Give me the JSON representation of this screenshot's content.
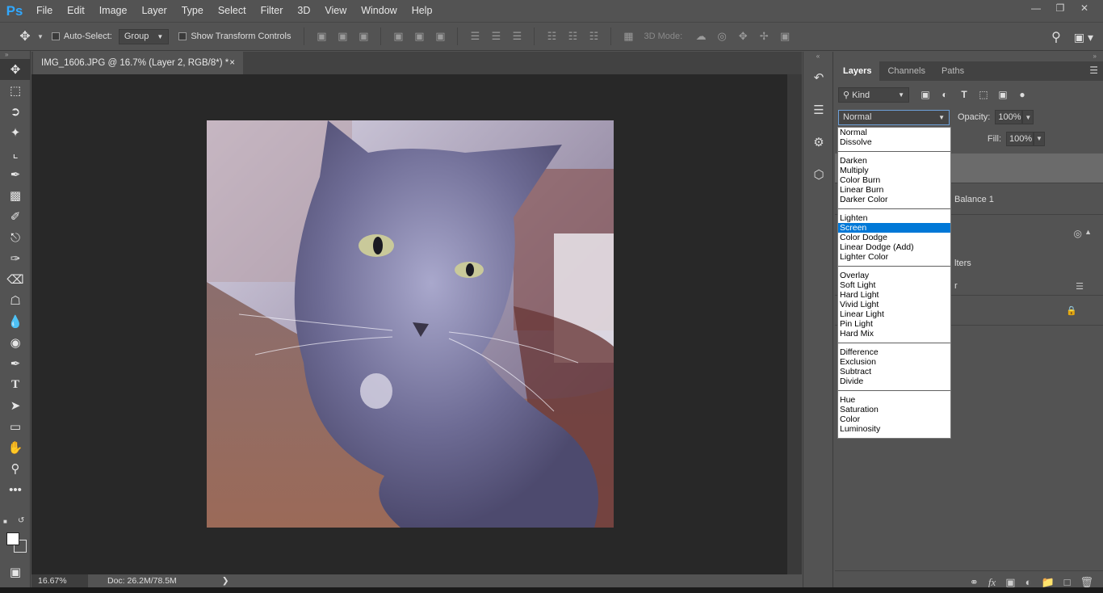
{
  "app": {
    "logo": "Ps",
    "menu": [
      "File",
      "Edit",
      "Image",
      "Layer",
      "Type",
      "Select",
      "Filter",
      "3D",
      "View",
      "Window",
      "Help"
    ]
  },
  "options": {
    "auto_select_label": "Auto-Select:",
    "auto_select_value": "Group",
    "show_transform_label": "Show Transform Controls",
    "mode_3d_label": "3D Mode:"
  },
  "document": {
    "tab_title": "IMG_1606.JPG @ 16.7% (Layer 2, RGB/8*) *",
    "tab_close": "×",
    "zoom": "16.67%",
    "doc_info": "Doc: 26.2M/78.5M",
    "status_arrow": "❯"
  },
  "layers_panel": {
    "tabs": [
      "Layers",
      "Channels",
      "Paths"
    ],
    "active_tab": "Layers",
    "filter_kind": "Kind",
    "blend_mode": "Normal",
    "opacity_label": "Opacity:",
    "opacity_value": "100%",
    "fill_label": "Fill:",
    "fill_value": "100%",
    "visible_layer_text": [
      "Balance 1",
      "lters",
      "r"
    ]
  },
  "blend_dropdown": {
    "groups": [
      [
        "Normal",
        "Dissolve"
      ],
      [
        "Darken",
        "Multiply",
        "Color Burn",
        "Linear Burn",
        "Darker Color"
      ],
      [
        "Lighten",
        "Screen",
        "Color Dodge",
        "Linear Dodge (Add)",
        "Lighter Color"
      ],
      [
        "Overlay",
        "Soft Light",
        "Hard Light",
        "Vivid Light",
        "Linear Light",
        "Pin Light",
        "Hard Mix"
      ],
      [
        "Difference",
        "Exclusion",
        "Subtract",
        "Divide"
      ],
      [
        "Hue",
        "Saturation",
        "Color",
        "Luminosity"
      ]
    ],
    "highlighted": "Screen"
  },
  "colors": {
    "accent_highlight": "#0078d7",
    "ps_logo": "#31a8ff",
    "foreground_swatch": "#ffffff"
  }
}
